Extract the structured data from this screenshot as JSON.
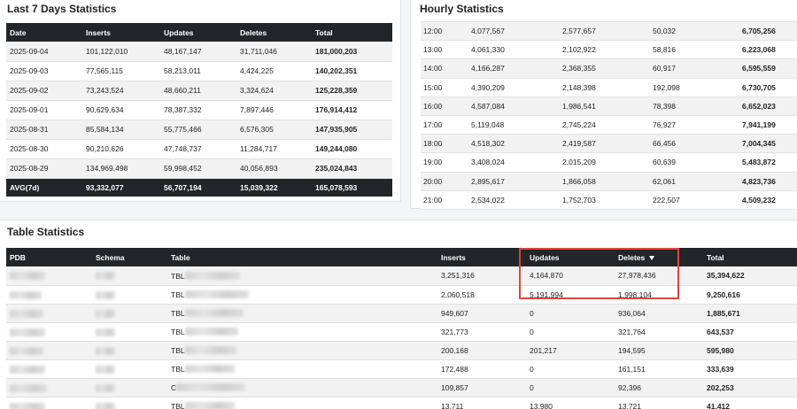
{
  "last7": {
    "title": "Last 7 Days Statistics",
    "columns": [
      "Date",
      "Inserts",
      "Updates",
      "Deletes",
      "Total"
    ],
    "rows": [
      {
        "date": "2025-09-04",
        "inserts": "101,122,010",
        "updates": "48,167,147",
        "deletes": "31,711,046",
        "total": "181,000,203"
      },
      {
        "date": "2025-09-03",
        "inserts": "77,565,115",
        "updates": "58,213,011",
        "deletes": "4,424,225",
        "total": "140,202,351"
      },
      {
        "date": "2025-09-02",
        "inserts": "73,243,524",
        "updates": "48,660,211",
        "deletes": "3,324,624",
        "total": "125,228,359"
      },
      {
        "date": "2025-09-01",
        "inserts": "90,629,634",
        "updates": "78,387,332",
        "deletes": "7,897,446",
        "total": "176,914,412"
      },
      {
        "date": "2025-08-31",
        "inserts": "85,584,134",
        "updates": "55,775,466",
        "deletes": "6,576,305",
        "total": "147,935,905"
      },
      {
        "date": "2025-08-30",
        "inserts": "90,210,626",
        "updates": "47,748,737",
        "deletes": "11,284,717",
        "total": "149,244,080"
      },
      {
        "date": "2025-08-29",
        "inserts": "134,969,498",
        "updates": "59,998,452",
        "deletes": "40,056,893",
        "total": "235,024,843"
      }
    ],
    "avg": {
      "label": "AVG(7d)",
      "inserts": "93,332,077",
      "updates": "56,707,194",
      "deletes": "15,039,322",
      "total": "165,078,593"
    }
  },
  "hourly": {
    "title": "Hourly Statistics",
    "rows": [
      {
        "hour": "12:00",
        "inserts": "4,077,567",
        "updates": "2,577,657",
        "deletes": "50,032",
        "total": "6,705,256"
      },
      {
        "hour": "13:00",
        "inserts": "4,061,330",
        "updates": "2,102,922",
        "deletes": "58,816",
        "total": "6,223,068"
      },
      {
        "hour": "14:00",
        "inserts": "4,166,287",
        "updates": "2,368,355",
        "deletes": "60,917",
        "total": "6,595,559"
      },
      {
        "hour": "15:00",
        "inserts": "4,390,209",
        "updates": "2,148,398",
        "deletes": "192,098",
        "total": "6,730,705"
      },
      {
        "hour": "16:00",
        "inserts": "4,587,084",
        "updates": "1,986,541",
        "deletes": "78,398",
        "total": "6,652,023"
      },
      {
        "hour": "17:00",
        "inserts": "5,119,048",
        "updates": "2,745,224",
        "deletes": "76,927",
        "total": "7,941,199"
      },
      {
        "hour": "18:00",
        "inserts": "4,518,302",
        "updates": "2,419,587",
        "deletes": "66,456",
        "total": "7,004,345"
      },
      {
        "hour": "19:00",
        "inserts": "3,408,024",
        "updates": "2,015,209",
        "deletes": "60,639",
        "total": "5,483,872"
      },
      {
        "hour": "20:00",
        "inserts": "2,895,617",
        "updates": "1,866,058",
        "deletes": "62,061",
        "total": "4,823,736"
      },
      {
        "hour": "21:00",
        "inserts": "2,534,022",
        "updates": "1,752,703",
        "deletes": "222,507",
        "total": "4,509,232"
      }
    ]
  },
  "tables": {
    "title": "Table Statistics",
    "columns": {
      "pdb": "PDB",
      "schema": "Schema",
      "table": "Table",
      "inserts": "Inserts",
      "updates": "Updates",
      "deletes": "Deletes",
      "total": "Total"
    },
    "sort_icon": "sort-desc-icon",
    "rows": [
      {
        "table_prefix": "TBL",
        "inserts": "3,251,316",
        "updates": "4,164,870",
        "deletes": "27,978,436",
        "total": "35,394,622"
      },
      {
        "table_prefix": "TBL",
        "inserts": "2,060,518",
        "updates": "5,191,994",
        "deletes": "1,998,104",
        "total": "9,250,616"
      },
      {
        "table_prefix": "TBL",
        "inserts": "949,607",
        "updates": "0",
        "deletes": "936,064",
        "total": "1,885,671"
      },
      {
        "table_prefix": "TBL",
        "inserts": "321,773",
        "updates": "0",
        "deletes": "321,764",
        "total": "643,537"
      },
      {
        "table_prefix": "TBL",
        "inserts": "200,168",
        "updates": "201,217",
        "deletes": "194,595",
        "total": "595,980"
      },
      {
        "table_prefix": "TBL",
        "inserts": "172,488",
        "updates": "0",
        "deletes": "161,151",
        "total": "333,639"
      },
      {
        "table_prefix": "C",
        "inserts": "109,857",
        "updates": "0",
        "deletes": "92,396",
        "total": "202,253"
      },
      {
        "table_prefix": "TBL",
        "inserts": "13,711",
        "updates": "13,980",
        "deletes": "13,721",
        "total": "41,412"
      }
    ]
  },
  "colors": {
    "header_bg": "#232629",
    "highlight": "#e0443f",
    "stripe": "#f2f2f2"
  }
}
